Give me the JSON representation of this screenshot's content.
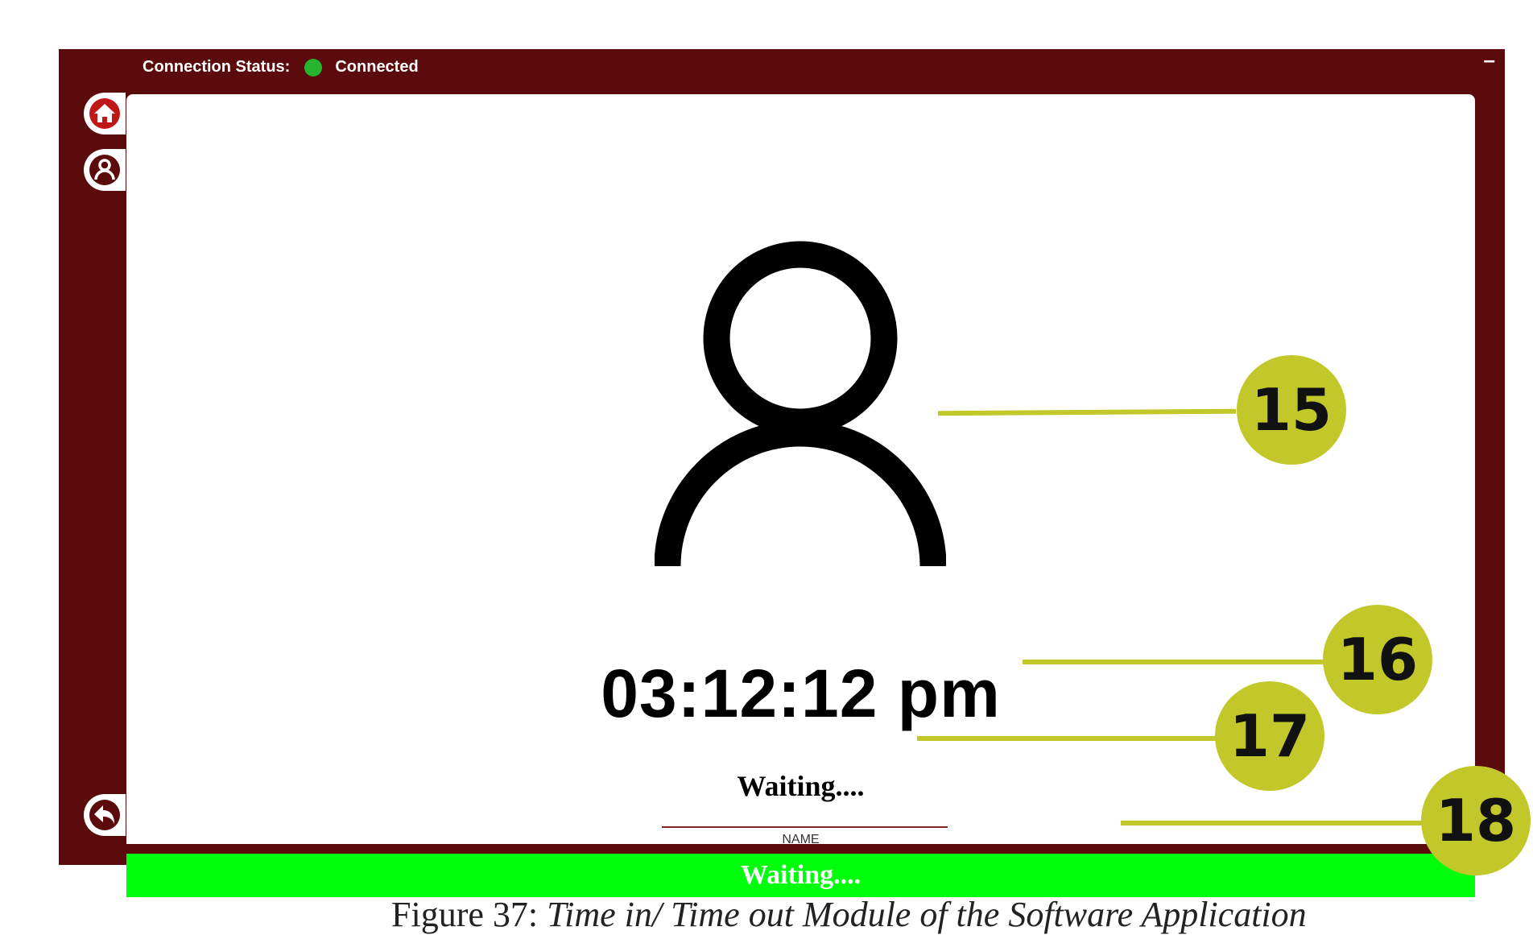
{
  "header": {
    "connection_label": "Connection Status:",
    "connection_value": "Connected",
    "minimize_label": "–"
  },
  "sidebar": {
    "items": [
      {
        "name": "home",
        "icon": "home-icon"
      },
      {
        "name": "profile",
        "icon": "user-icon"
      },
      {
        "name": "back",
        "icon": "back-arrow-icon"
      }
    ]
  },
  "main": {
    "clock": "03:12:12 pm",
    "employee_name": "Waiting....",
    "name_label": "NAME"
  },
  "status_banner": {
    "text": "Waiting...."
  },
  "callouts": [
    "15",
    "16",
    "17",
    "18"
  ],
  "caption": {
    "label": "Figure 37:",
    "title": "Time in/ Time out Module of the Software Application"
  },
  "colors": {
    "frame": "#5c0b0c",
    "connected_dot": "#27b52f",
    "banner": "#00ff0d",
    "callout": "#c2c82a"
  }
}
